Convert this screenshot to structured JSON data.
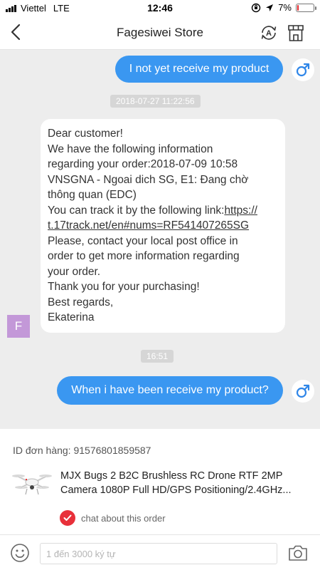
{
  "status_bar": {
    "carrier": "Viettel",
    "network": "LTE",
    "time": "12:46",
    "battery_percent": "7%",
    "battery_level": 0.07
  },
  "header": {
    "title": "Fagesiwei Store",
    "translate_icon_letter": "A"
  },
  "chat": {
    "messages": [
      {
        "from": "me",
        "text": "I not yet receive my product"
      },
      {
        "from": "store",
        "lines": [
          "Dear customer!",
          "We have the following information",
          "regarding your order:2018-07-09 10:58",
          "VNSGNA - Ngoai dich SG, E1: Đang chờ",
          "thông quan (EDC)",
          "You can track it by the following link:",
          "https://",
          "t.17track.net/en#nums=RF541407265SG",
          "Please, contact your local post office in",
          "order to get more information regarding",
          "your order.",
          "Thank you for your purchasing!",
          "Best regards,",
          "Ekaterina"
        ]
      },
      {
        "from": "me",
        "text": "When i have been receive my product?"
      }
    ],
    "timestamps": [
      "2018-07-27 11:22:56",
      "16:51"
    ],
    "store_avatar_letter": "F"
  },
  "order": {
    "id_label": "ID đơn hàng: 91576801859587",
    "product_title_line1": "MJX Bugs 2 B2C Brushless RC Drone RTF 2MP",
    "product_title_line2": "Camera 1080P Full HD/GPS Positioning/2.4GHz...",
    "chat_about_label": "chat about this order"
  },
  "input_bar": {
    "placeholder": "1 đến 3000 ký tự"
  },
  "colors": {
    "outgoing_bubble": "#3a97f1",
    "male_icon": "#2f86e8",
    "store_avatar": "#c398d8",
    "check_badge": "#e8303a"
  },
  "icons": [
    "back-chevron-icon",
    "translate-icon",
    "store-icon",
    "male-symbol-icon",
    "emoji-icon",
    "camera-icon",
    "checkmark-icon",
    "location-icon",
    "orientation-lock-icon"
  ]
}
